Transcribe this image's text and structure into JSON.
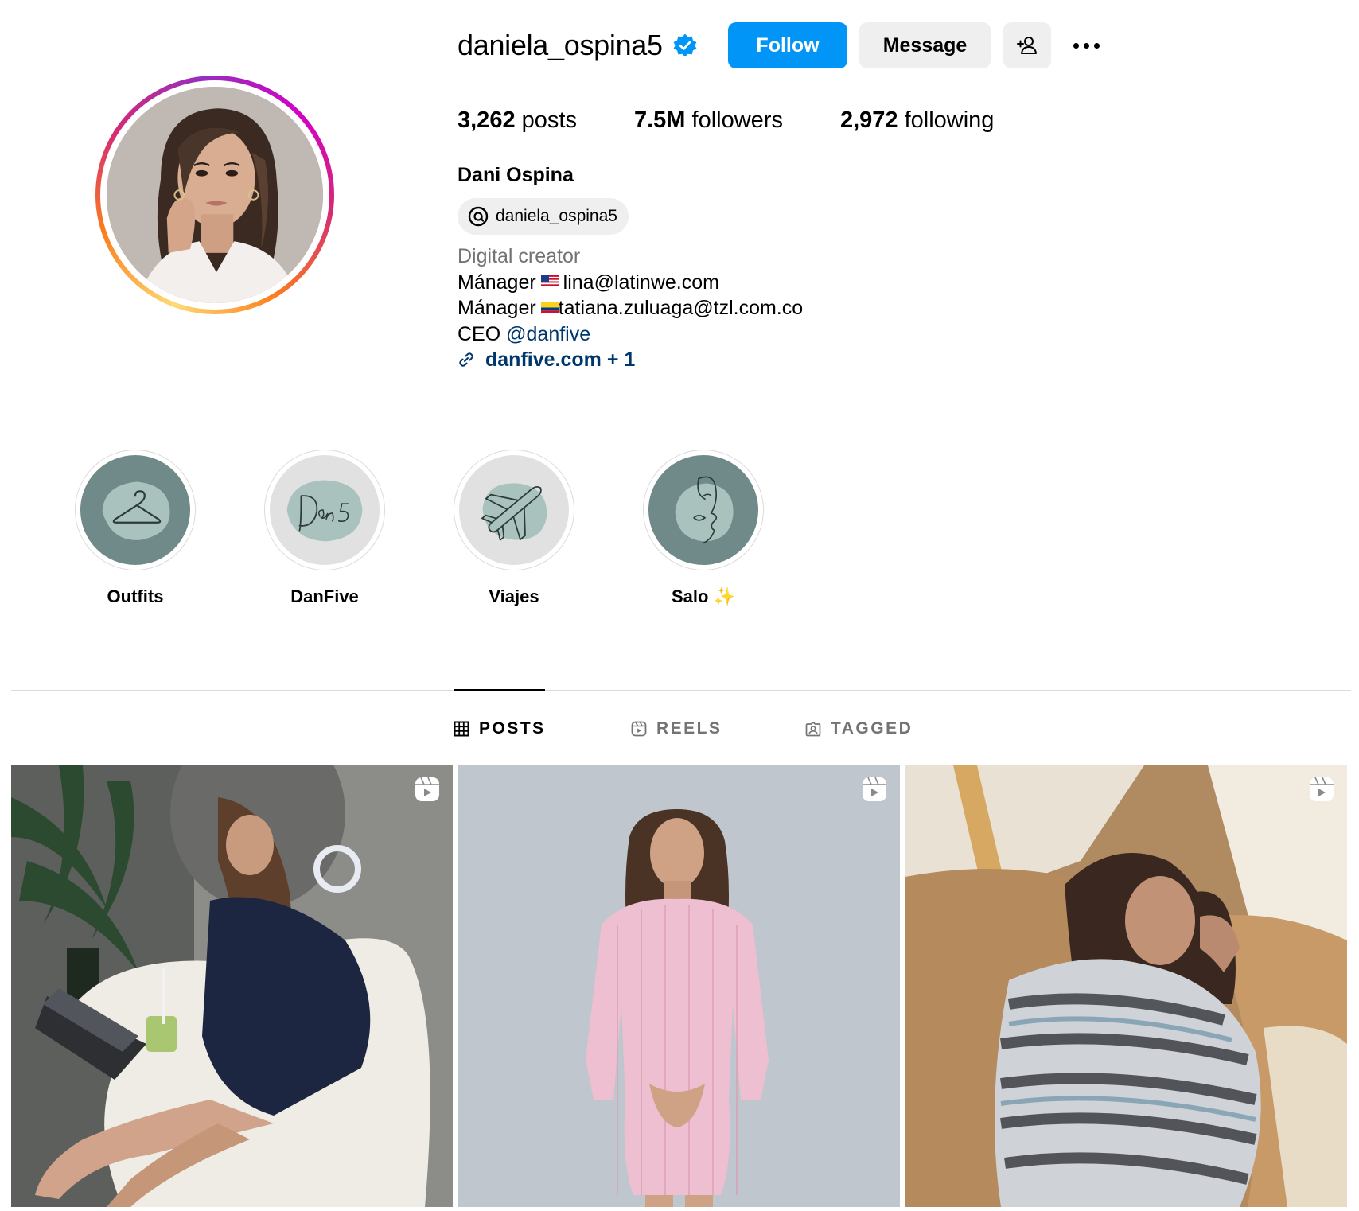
{
  "profile": {
    "username": "daniela_ospina5",
    "follow_label": "Follow",
    "message_label": "Message",
    "stats": {
      "posts_count": "3,262",
      "posts_label": "posts",
      "followers_count": "7.5M",
      "followers_label": "followers",
      "following_count": "2,972",
      "following_label": "following"
    },
    "full_name": "Dani Ospina",
    "threads_handle": "daniela_ospina5",
    "category": "Digital creator",
    "bio": {
      "line1_prefix": "Mánager",
      "line1_email": "lina@latinwe.com",
      "line2_prefix": "Mánager",
      "line2_email": "tatiana.zuluaga@tzl.com.co",
      "line3_prefix": "CEO",
      "line3_mention": "@danfive",
      "link": "danfive.com + 1"
    }
  },
  "highlights": [
    {
      "label": "Outfits",
      "icon": "hanger-icon"
    },
    {
      "label": "DanFive",
      "icon": "danfive-signature-icon"
    },
    {
      "label": "Viajes",
      "icon": "airplane-icon"
    },
    {
      "label": "Salo",
      "emoji": "✨",
      "icon": "face-line-art-icon"
    }
  ],
  "tabs": [
    {
      "label": "POSTS",
      "active": true,
      "icon": "grid-icon"
    },
    {
      "label": "REELS",
      "active": false,
      "icon": "reels-icon"
    },
    {
      "label": "TAGGED",
      "active": false,
      "icon": "tagged-icon"
    }
  ],
  "posts": [
    {
      "type": "reel",
      "icon": "reel-icon"
    },
    {
      "type": "reel",
      "icon": "reel-icon"
    },
    {
      "type": "reel",
      "icon": "reel-icon"
    }
  ],
  "colors": {
    "follow_button": "#0095f6",
    "secondary_button": "#efefef",
    "link": "#00376b",
    "muted": "#737373",
    "verified": "#0095f6",
    "highlight_teal": "#6f8a88"
  }
}
